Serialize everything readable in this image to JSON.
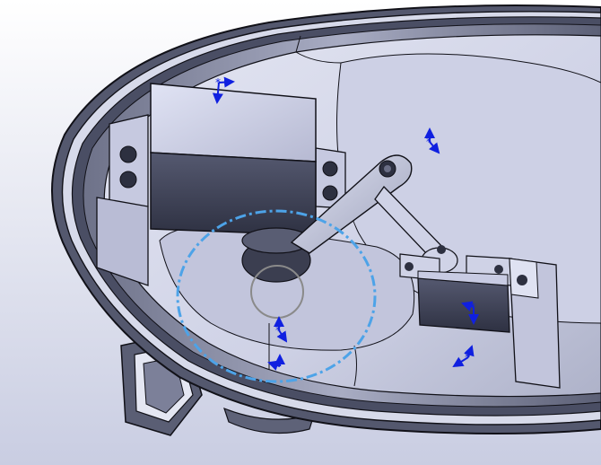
{
  "viewport": {
    "background_top": "#ffffff",
    "background_bottom": "#c9cde2"
  },
  "model": {
    "shell_color": "#8e93ab",
    "shell_dark": "#3f4254",
    "shell_rim": "#d7daea",
    "interior_floor": "#d3d6e8",
    "servo_color": "#c8cbe3",
    "servo_dark": "#4a4e66",
    "edge_color": "#111118"
  },
  "overlays": {
    "reference_circle_color": "#4da3e8",
    "triad_color": "#1020e0",
    "selection_circle_color": "#8a8a8a",
    "triad_icons": [
      "triad-icon",
      "triad-icon",
      "triad-icon",
      "triad-icon",
      "triad-icon",
      "triad-icon"
    ]
  }
}
